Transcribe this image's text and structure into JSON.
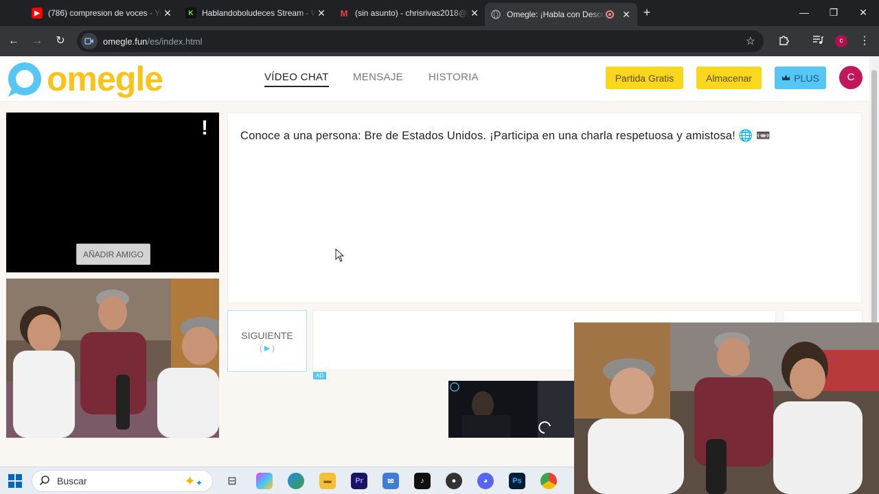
{
  "browser": {
    "tabs": [
      {
        "title": "(786) compresion de voces - Yo",
        "icon": "youtube-icon",
        "color": "#ff0000",
        "active": false
      },
      {
        "title": "Hablandoboludeces Stream - W",
        "icon": "kick-icon",
        "color": "#53fc18",
        "active": false
      },
      {
        "title": "(sin asunto) - chrisrivas2018@g",
        "icon": "gmail-icon",
        "color": "#ea4335",
        "active": false
      },
      {
        "title": "Omegle: ¡Habla con Descon",
        "icon": "globe-icon",
        "color": "#9aa0a6",
        "active": true
      }
    ],
    "url_host": "omegle.fun",
    "url_path": "/es/index.html",
    "profile_letter": "c"
  },
  "site": {
    "logo_text": "omegle",
    "nav": [
      {
        "label": "VÍDEO CHAT",
        "active": true
      },
      {
        "label": "MENSAJE",
        "active": false
      },
      {
        "label": "HISTORIA",
        "active": false
      }
    ],
    "free_game_label": "Partida Gratis",
    "store_label": "Almacenar",
    "plus_label": "PLUS",
    "user_letter": "C"
  },
  "chat": {
    "stranger_alert": "!",
    "add_friend_label": "AÑADIR AMIGO",
    "message": "Conoce a una persona: Bre de Estados Unidos. ¡Participa en una charla respetuosa y amistosa! 🌐 📼",
    "next_label": "SIGUIENTE",
    "ad_label": "AD"
  },
  "taskbar": {
    "search_placeholder": "Buscar"
  }
}
